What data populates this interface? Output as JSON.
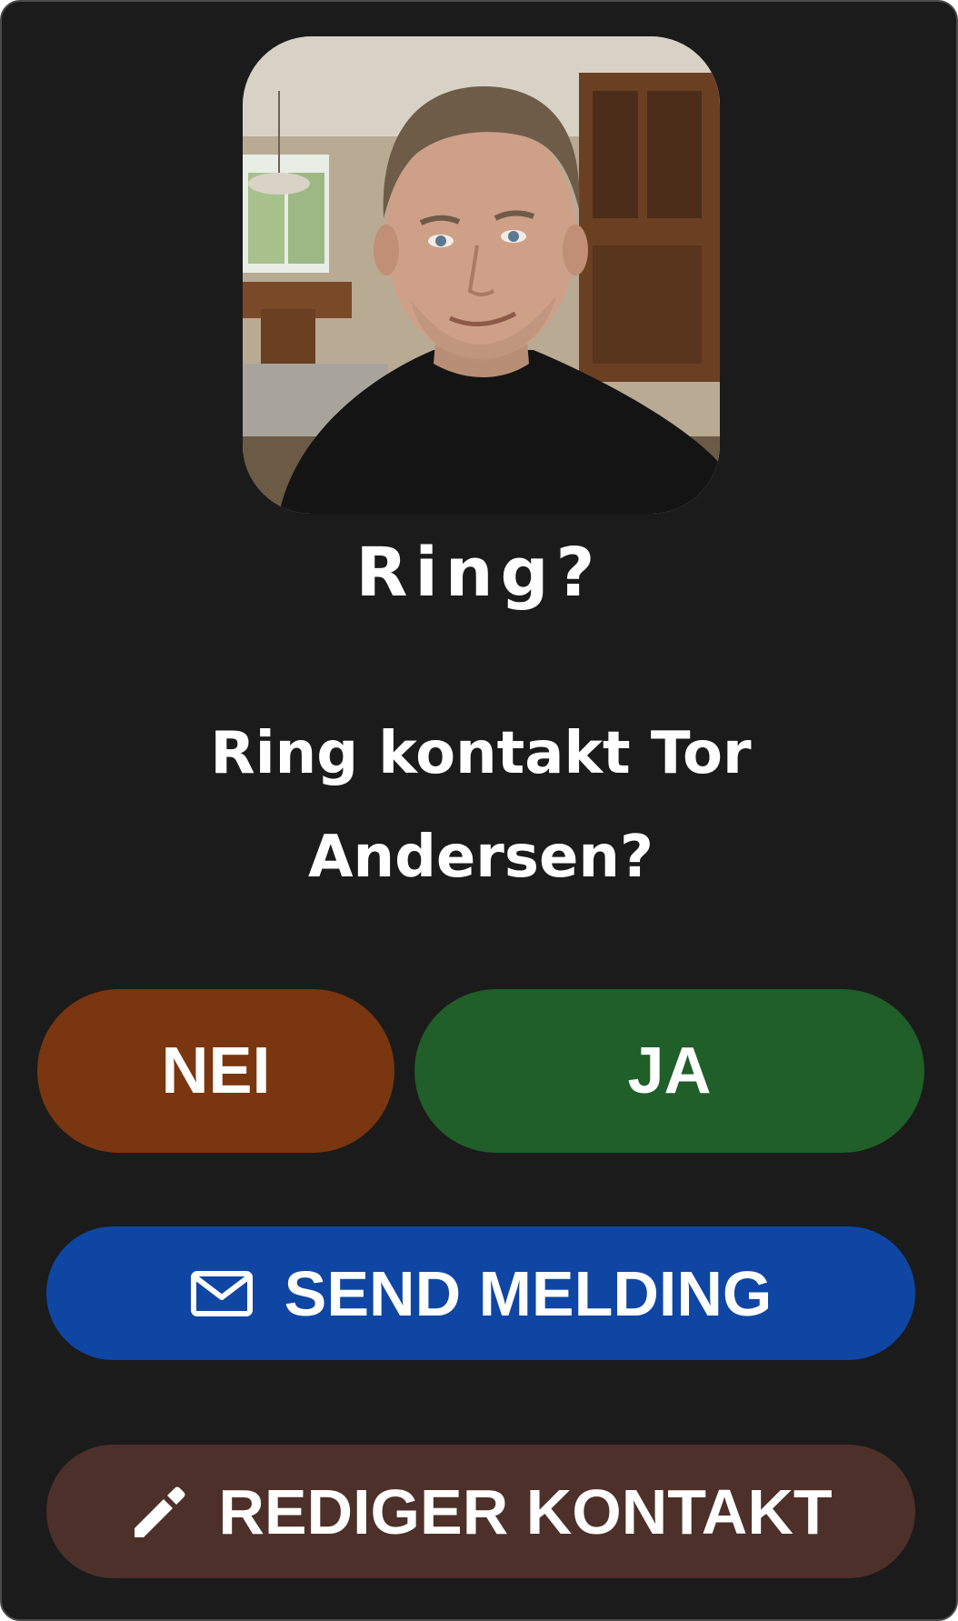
{
  "dialog": {
    "title": "Ring?",
    "message": "Ring kontakt Tor Andersen?"
  },
  "contact": {
    "photo_alt": "Tor Andersen"
  },
  "buttons": {
    "no_label": "NEI",
    "yes_label": "JA",
    "send_message_label": "SEND MELDING",
    "send_message_icon": "mail-icon",
    "edit_contact_label": "REDIGER KONTAKT",
    "edit_contact_icon": "pencil-icon"
  },
  "colors": {
    "background": "#1b1b1b",
    "no_button": "#7a3610",
    "yes_button": "#205e2a",
    "send_button": "#0f46a3",
    "edit_button": "#4d3029",
    "text": "#ffffff"
  }
}
